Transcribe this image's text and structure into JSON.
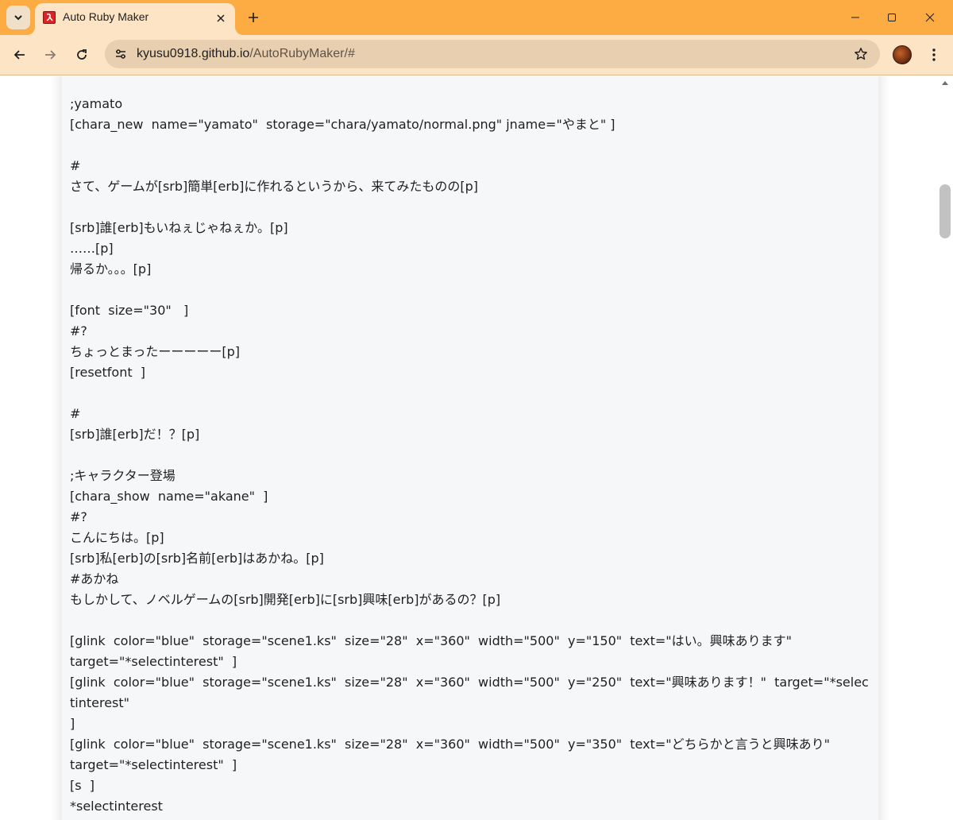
{
  "browser": {
    "tab": {
      "title": "Auto Ruby Maker"
    },
    "address": {
      "domain": "kyusu0918.github.io",
      "path": "/AutoRubyMaker/#"
    },
    "icons": {
      "tab_search": "chevron-down-icon",
      "favicon": "ruby-maker-favicon",
      "close": "close-icon",
      "new_tab": "plus-icon",
      "back": "arrow-left-icon",
      "forward": "arrow-right-icon",
      "reload": "reload-icon",
      "site_info": "tune-icon",
      "bookmark": "star-icon",
      "menu": "kebab-menu-icon"
    },
    "theme": {
      "frame": "#fdac43",
      "toolbar": "#fde4c4",
      "omnibox": "#e8cfb0"
    }
  },
  "page": {
    "lines": [
      ";yamato",
      "[chara_new  name=\"yamato\"  storage=\"chara/yamato/normal.png\" jname=\"やまと\" ]",
      "",
      "#",
      "さて、ゲームが[srb]簡単[erb]に作れるというから、来てみたものの[p]",
      "",
      "[srb]誰[erb]もいねぇじゃねぇか。[p]",
      "……[p]",
      "帰るか。。。[p]",
      "",
      "[font  size=\"30\"   ]",
      "#?",
      "ちょっとまったーーーーー[p]",
      "[resetfont  ]",
      "",
      "#",
      "[srb]誰[erb]だ！？[p]",
      "",
      ";キャラクター登場",
      "[chara_show  name=\"akane\"  ]",
      "#?",
      "こんにちは。[p]",
      "[srb]私[erb]の[srb]名前[erb]はあかね。[p]",
      "#あかね",
      "もしかして、ノベルゲームの[srb]開発[erb]に[srb]興味[erb]があるの？[p]",
      "",
      "[glink  color=\"blue\"  storage=\"scene1.ks\"  size=\"28\"  x=\"360\"  width=\"500\"  y=\"150\"  text=\"はい。興味あります\"\ntarget=\"*selectinterest\"  ]",
      "[glink  color=\"blue\"  storage=\"scene1.ks\"  size=\"28\"  x=\"360\"  width=\"500\"  y=\"250\"  text=\"興味あります！\"  target=\"*selectinterest\"\n]",
      "[glink  color=\"blue\"  storage=\"scene1.ks\"  size=\"28\"  x=\"360\"  width=\"500\"  y=\"350\"  text=\"どちらかと言うと興味あり\"\ntarget=\"*selectinterest\"  ]",
      "[s  ]",
      "*selectinterest"
    ]
  }
}
